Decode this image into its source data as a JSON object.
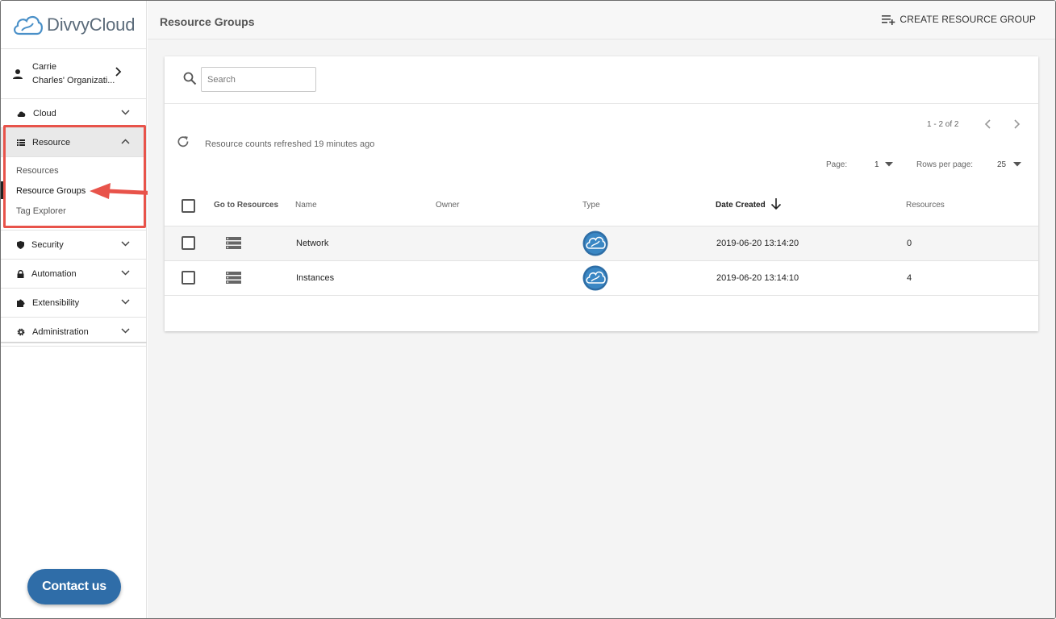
{
  "brand": {
    "name": "DivvyCloud"
  },
  "user": {
    "name": "Carrie",
    "org": "Charles' Organizati..."
  },
  "nav": {
    "cloud": "Cloud",
    "resource": "Resource",
    "resource_sub": [
      "Resources",
      "Resource Groups",
      "Tag Explorer"
    ],
    "security": "Security",
    "automation": "Automation",
    "extensibility": "Extensibility",
    "administration": "Administration"
  },
  "contact_label": "Contact us",
  "header": {
    "title": "Resource Groups",
    "create_label": "CREATE RESOURCE GROUP"
  },
  "search": {
    "placeholder": "Search"
  },
  "refresh_text": "Resource counts refreshed 19 minutes ago",
  "pagination": {
    "range": "1 - 2 of 2",
    "page_label": "Page:",
    "page": "1",
    "rows_label": "Rows per page:",
    "rows": "25"
  },
  "table": {
    "columns": [
      "Go to Resources",
      "Name",
      "Owner",
      "Type",
      "Date Created",
      "Resources"
    ],
    "rows": [
      {
        "name": "Network",
        "owner": "",
        "date": "2019-06-20 13:14:20",
        "resources": "0"
      },
      {
        "name": "Instances",
        "owner": "",
        "date": "2019-06-20 13:14:10",
        "resources": "4"
      }
    ]
  },
  "colors": {
    "accent": "#2f6da8",
    "highlight": "#e8534a"
  }
}
